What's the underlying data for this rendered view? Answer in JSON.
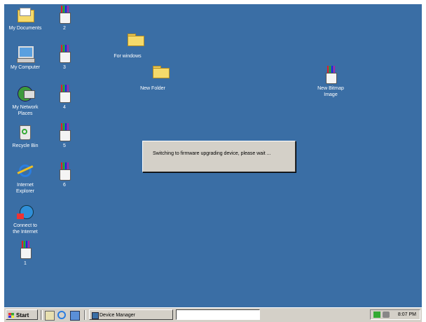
{
  "desktop": {
    "background_color": "#3a6ea5",
    "icons": [
      {
        "key": "my_documents",
        "label": "My Documents",
        "icon": "my-documents-icon"
      },
      {
        "key": "my_computer",
        "label": "My Computer",
        "icon": "my-computer-icon"
      },
      {
        "key": "network",
        "label": "My Network\nPlaces",
        "icon": "network-places-icon"
      },
      {
        "key": "recycle",
        "label": "Recycle Bin",
        "icon": "recycle-bin-icon"
      },
      {
        "key": "ie",
        "label": "Internet\nExplorer",
        "icon": "internet-explorer-icon"
      },
      {
        "key": "connect",
        "label": "Connect to\nthe Internet",
        "icon": "connect-internet-icon"
      },
      {
        "key": "p1",
        "label": "1",
        "icon": "paint-bitmap-icon"
      },
      {
        "key": "p2",
        "label": "2",
        "icon": "paint-bitmap-icon"
      },
      {
        "key": "p3",
        "label": "3",
        "icon": "paint-bitmap-icon"
      },
      {
        "key": "p4",
        "label": "4",
        "icon": "paint-bitmap-icon"
      },
      {
        "key": "p5",
        "label": "5",
        "icon": "paint-bitmap-icon"
      },
      {
        "key": "p6",
        "label": "6",
        "icon": "paint-bitmap-icon"
      },
      {
        "key": "for_windows",
        "label": "For windows",
        "icon": "folder-icon"
      },
      {
        "key": "new_folder",
        "label": "New Folder",
        "icon": "folder-icon"
      },
      {
        "key": "new_bitmap",
        "label": "New Bitmap\nImage",
        "icon": "paint-bitmap-icon"
      }
    ]
  },
  "dialog": {
    "message": "Switching to firmware upgrading device, please wait ..."
  },
  "taskbar": {
    "start_label": "Start",
    "quick_launch": [
      "show-desktop-icon",
      "internet-explorer-icon",
      "outlook-express-icon"
    ],
    "tasks": [
      {
        "label": "Device Manager",
        "icon": "device-manager-icon"
      }
    ],
    "clock": "8:07 PM",
    "tray_icons": [
      "network-tray-icon",
      "volume-tray-icon"
    ]
  }
}
